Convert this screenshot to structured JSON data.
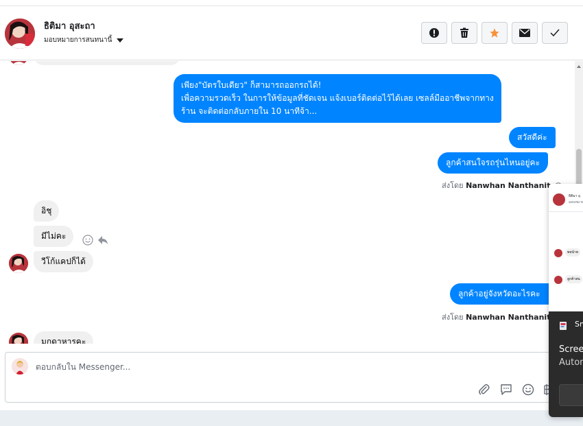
{
  "header": {
    "contact_name": "ธิติมา อุสะถา",
    "assign_label": "มอบหมายการสนทนานี้",
    "buttons": [
      {
        "name": "report-button",
        "icon": "exclamation-icon"
      },
      {
        "name": "delete-button",
        "icon": "trash-icon"
      },
      {
        "name": "star-button",
        "icon": "star-icon",
        "color": "#f7923a"
      },
      {
        "name": "mark-unread-button",
        "icon": "envelope-icon"
      },
      {
        "name": "done-button",
        "icon": "check-icon"
      }
    ]
  },
  "messages": {
    "out_promo_line1": "เพียง\"บัตรใบเดียว\" ก็สามารถออกรถได้!",
    "out_promo_line2": "เพื่อความรวดเร็ว ในการให้ข้อมูลที่ชัดเจน แจ้งเบอร์ติดต่อไว้ได้เลย เซลล์มืออาชีพจากทาง",
    "out_promo_line3": "ร้าน จะติดต่อกลับภายใน 10 นาทีจ้า...",
    "out_hello": "สวัสดีค่ะ",
    "out_interest": "ลูกค้าสนใจรถรุ่นไหนอยู่คะ",
    "sent_by_label": "ส่งโดย",
    "sent_by_name": "Nanwhan Nanthanit",
    "in_1": "อิชุ",
    "in_2": "มีไม่คะ",
    "in_3": "วีโก้แคปก็ได้",
    "out_province": "ลูกค้าอยู่จังหวัดอะไรคะ",
    "in_4": "มุกดาหารคะ"
  },
  "reply": {
    "placeholder": "ตอบกลับใน Messenger..."
  },
  "popup": {
    "text_1": "ธิติมา อุ",
    "text_2": "มอบหมาย",
    "text_3": "พหน้าท",
    "text_4": "ลูกค้าสน",
    "app_label": "Sn",
    "line_1": "Screen",
    "line_2": "Autom"
  },
  "colors": {
    "outgoing_bubble": "#0084ff",
    "incoming_bubble": "#f0f0f0",
    "star": "#f7923a"
  }
}
